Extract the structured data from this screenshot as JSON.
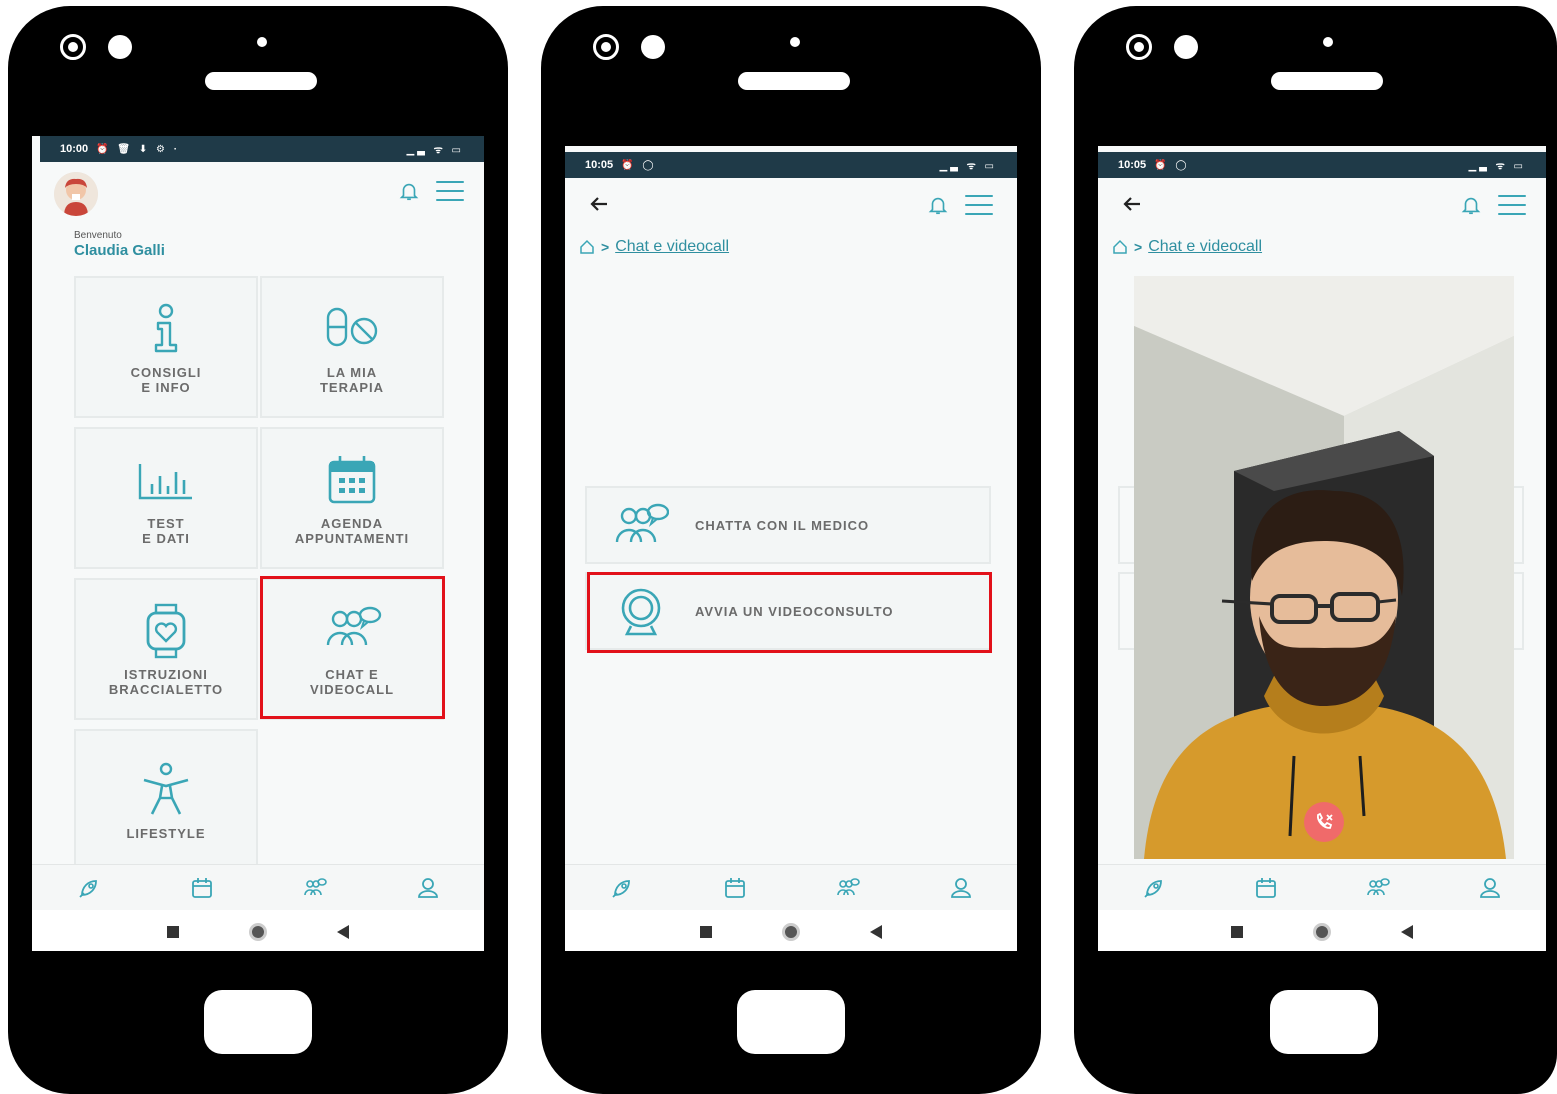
{
  "colors": {
    "accent": "#3aa6b6",
    "highlight": "#e2111a",
    "statusbar": "#1f3a48"
  },
  "screens": [
    {
      "status_time": "10:00",
      "status_left_icons": "⏰ 🗑 ⬇ ⚙ ·",
      "status_right_icons": "▁▃ ᯤ ▭",
      "welcome_label": "Benvenuto",
      "user_name": "Claudia Galli",
      "tiles": [
        {
          "label": "CONSIGLI\nE INFO",
          "icon": "info-person-icon"
        },
        {
          "label": "LA MIA\nTERAPIA",
          "icon": "pill-icon"
        },
        {
          "label": "TEST\nE DATI",
          "icon": "bar-chart-icon"
        },
        {
          "label": "AGENDA\nAPPUNTAMENTI",
          "icon": "calendar-icon"
        },
        {
          "label": "ISTRUZIONI\nBRACCIALETTO",
          "icon": "smartwatch-icon"
        },
        {
          "label": "CHAT E\nVIDEOCALL",
          "icon": "chat-people-icon"
        },
        {
          "label": "LIFESTYLE",
          "icon": "person-activity-icon"
        }
      ],
      "highlighted_tile": "CHAT E VIDEOCALL"
    },
    {
      "status_time": "10:05",
      "status_left_icons": "⏰ ◯",
      "status_right_icons": "▁▃ ᯤ ▭",
      "breadcrumb_link": "Chat e videocall",
      "actions": [
        {
          "label": "CHATTA CON IL MEDICO",
          "icon": "chat-people-icon"
        },
        {
          "label": "AVVIA UN VIDEOCONSULTO",
          "icon": "webcam-icon"
        }
      ],
      "highlighted_action": "AVVIA UN VIDEOCONSULTO"
    },
    {
      "status_time": "10:05",
      "status_left_icons": "⏰ ◯",
      "status_right_icons": "▁▃ ᯤ ▭",
      "breadcrumb_link": "Chat e videocall",
      "video_controls": {
        "hangup_icon": "hangup-phone-icon"
      }
    }
  ],
  "bottom_nav": [
    "rocket-icon",
    "calendar-icon",
    "chat-people-icon",
    "user-icon"
  ],
  "system_nav": [
    "recent-apps-square",
    "home-circle",
    "back-triangle"
  ]
}
